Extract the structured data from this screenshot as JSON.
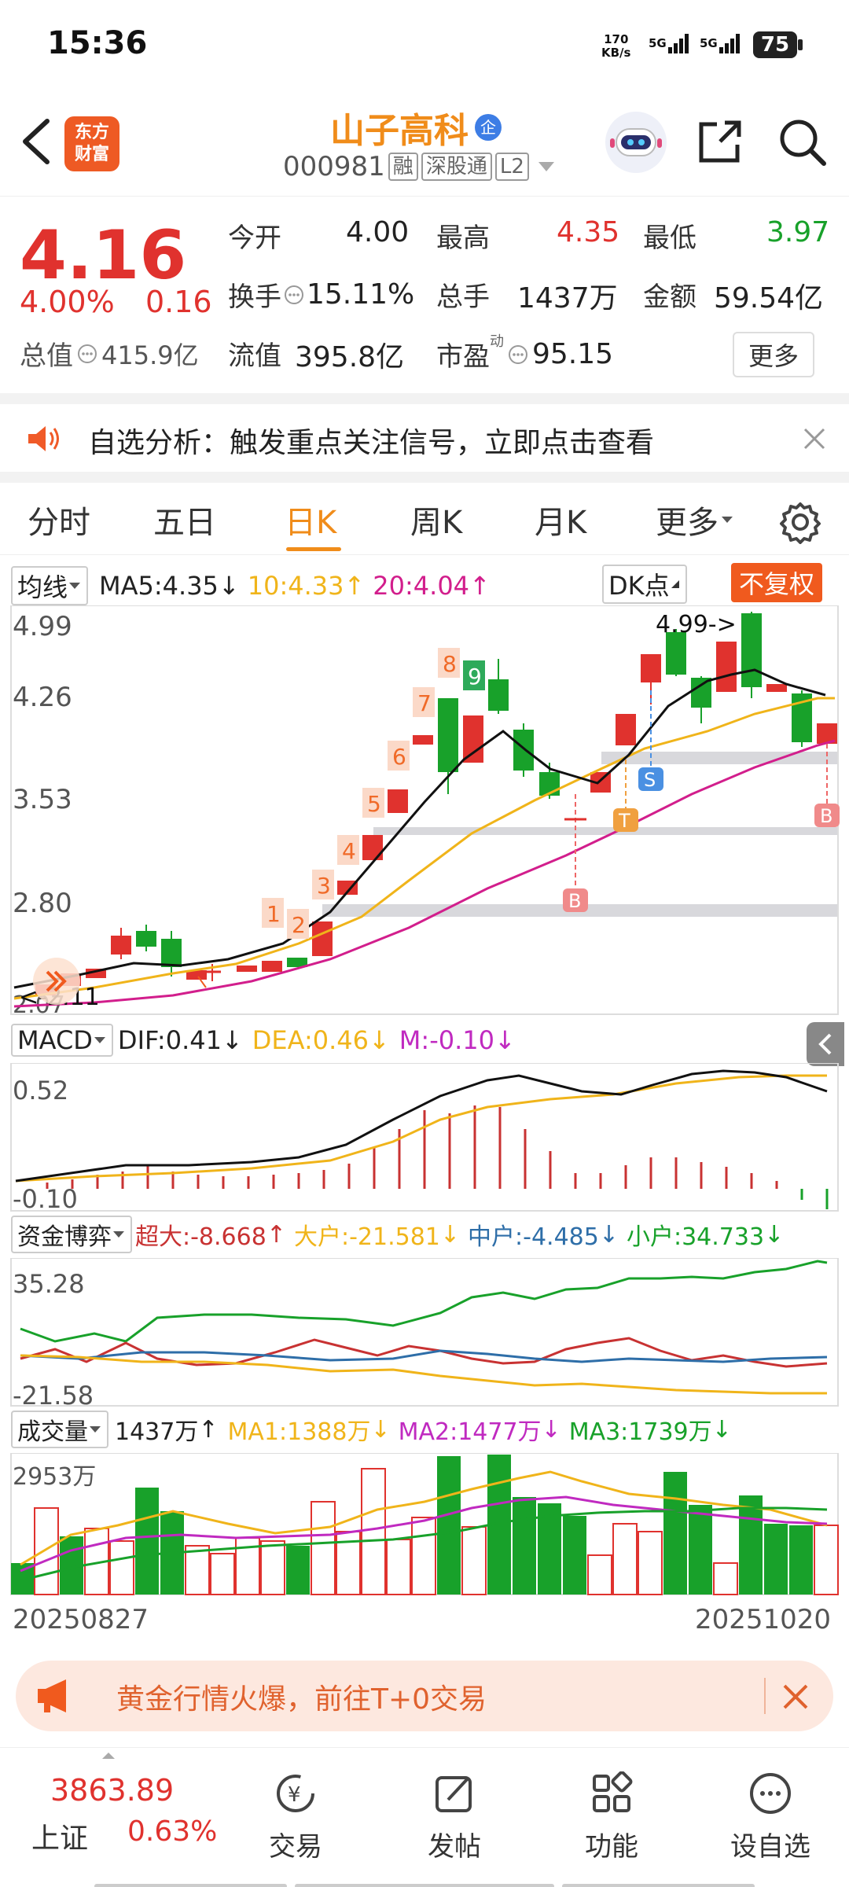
{
  "status": {
    "time": "15:36",
    "net_speed": "170",
    "net_unit": "KB/s",
    "sig1": "5G",
    "sig2": "5G",
    "battery": "75"
  },
  "header": {
    "logo_line1": "东方",
    "logo_line2": "财富",
    "stock_name": "山子高科",
    "badge": "企",
    "code": "000981",
    "tag_margin": "融",
    "tag_connect": "深股通",
    "tag_level": "L2"
  },
  "quote": {
    "price": "4.16",
    "change_pct": "4.00%",
    "change": "0.16",
    "open_label": "今开",
    "open": "4.00",
    "high_label": "最高",
    "high": "4.35",
    "low_label": "最低",
    "low": "3.97",
    "turnover_label": "换手",
    "turnover": "15.11%",
    "volume_label": "总手",
    "volume": "1437万",
    "amount_label": "金额",
    "amount": "59.54亿",
    "mcap_label": "总值",
    "mcap": "415.9亿",
    "float_label": "流值",
    "float": "395.8亿",
    "pe_label": "市盈",
    "pe_sup": "动",
    "pe": "95.15",
    "more": "更多"
  },
  "alert": {
    "text": "自选分析：触发重点关注信号，立即点击查看"
  },
  "tabs": [
    "分时",
    "五日",
    "日K",
    "周K",
    "月K",
    "更多"
  ],
  "ma_bar": {
    "select": "均线",
    "ma5": "MA5:4.35",
    "ma10": "10:4.33",
    "ma20": "20:4.04",
    "dk": "DK点",
    "adjust": "不复权"
  },
  "kline": {
    "y_labels": [
      "4.99",
      "4.26",
      "3.53",
      "2.80",
      "2.07"
    ],
    "top_annotation": "4.99->",
    "bottom_annotation": "<-2.11",
    "nums": [
      "1",
      "2",
      "3",
      "4",
      "5",
      "6",
      "7",
      "8",
      "9"
    ],
    "marks": {
      "B": "B",
      "S": "S",
      "T": "T"
    }
  },
  "macd_bar": {
    "select": "MACD",
    "dif": "DIF:0.41",
    "dea": "DEA:0.46",
    "m": "M:-0.10",
    "y_top": "0.52",
    "y_bottom": "-0.10"
  },
  "fund_bar": {
    "select": "资金博弈",
    "super": "超大:-8.668",
    "large": "大户:-21.581",
    "mid": "中户:-4.485",
    "small": "小户:34.733",
    "y_top": "35.28",
    "y_bottom": "-21.58"
  },
  "vol_bar": {
    "select": "成交量",
    "vol": "1437万",
    "ma1": "MA1:1388万",
    "ma2": "MA2:1477万",
    "ma3": "MA3:1739万",
    "y_top": "2953万"
  },
  "dates": {
    "start": "20250827",
    "end": "20251020"
  },
  "banner": {
    "text": "黄金行情火爆，前往T+0交易"
  },
  "bottomnav": {
    "index_value": "3863.89",
    "index_name": "上证",
    "index_pct": "0.63%",
    "items": [
      "交易",
      "发帖",
      "功能",
      "设自选"
    ]
  },
  "colors": {
    "up": "#e0322e",
    "down": "#18a12a",
    "accent": "#f08c1a"
  }
}
